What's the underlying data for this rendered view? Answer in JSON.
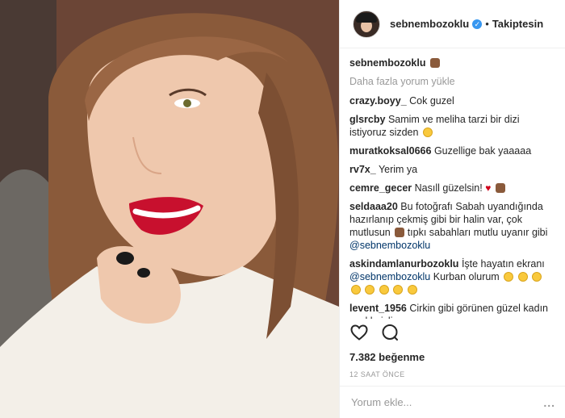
{
  "header": {
    "username": "sebnembozoklu",
    "follow_label": "Takiptesin",
    "separator": "•"
  },
  "caption": {
    "username": "sebnembozoklu",
    "emoji": "bear-emoji"
  },
  "load_more": "Daha fazla yorum yükle",
  "comments": [
    {
      "user": "crazy.boyy_",
      "text": "Cok guzel"
    },
    {
      "user": "glsrcby",
      "text": "Samim ve meliha tarzi bir dizi istiyoruz sizden"
    },
    {
      "user": "muratkoksal0666",
      "text": "Guzellige bak yaaaaa"
    },
    {
      "user": "rv7x_",
      "text": "Yerim ya"
    },
    {
      "user": "cemre_gecer",
      "text": "Nasıll güzelsin!"
    },
    {
      "user": "seldaaa20",
      "text": "Bu fotoğrafı Sabah uyandığında hazırlanıp çekmiş gibi bir halin var, çok mutlusun",
      "text2": "tıpkı sabahları mutlu uyanır gibi",
      "mention": "@sebnembozoklu"
    },
    {
      "user": "askindamlanurbozoklu",
      "text": "İşte hayatın ekranı",
      "mention": "@sebnembozoklu",
      "text2": "Kurban olurum"
    },
    {
      "user": "levent_1956",
      "text": "Cirkin gibi görünen güzel kadın zevkle izliyoruz"
    }
  ],
  "likes": "7.382 beğenme",
  "time": "12 SAAT ÖNCE",
  "add_comment_placeholder": "Yorum ekle...",
  "options": "...",
  "colors": {
    "verified": "#3897f0",
    "mention": "#003569",
    "muted": "#999999",
    "lipstick": "#c8102e"
  },
  "icons": [
    "heart-icon",
    "comment-icon",
    "verified-icon",
    "options-icon"
  ]
}
